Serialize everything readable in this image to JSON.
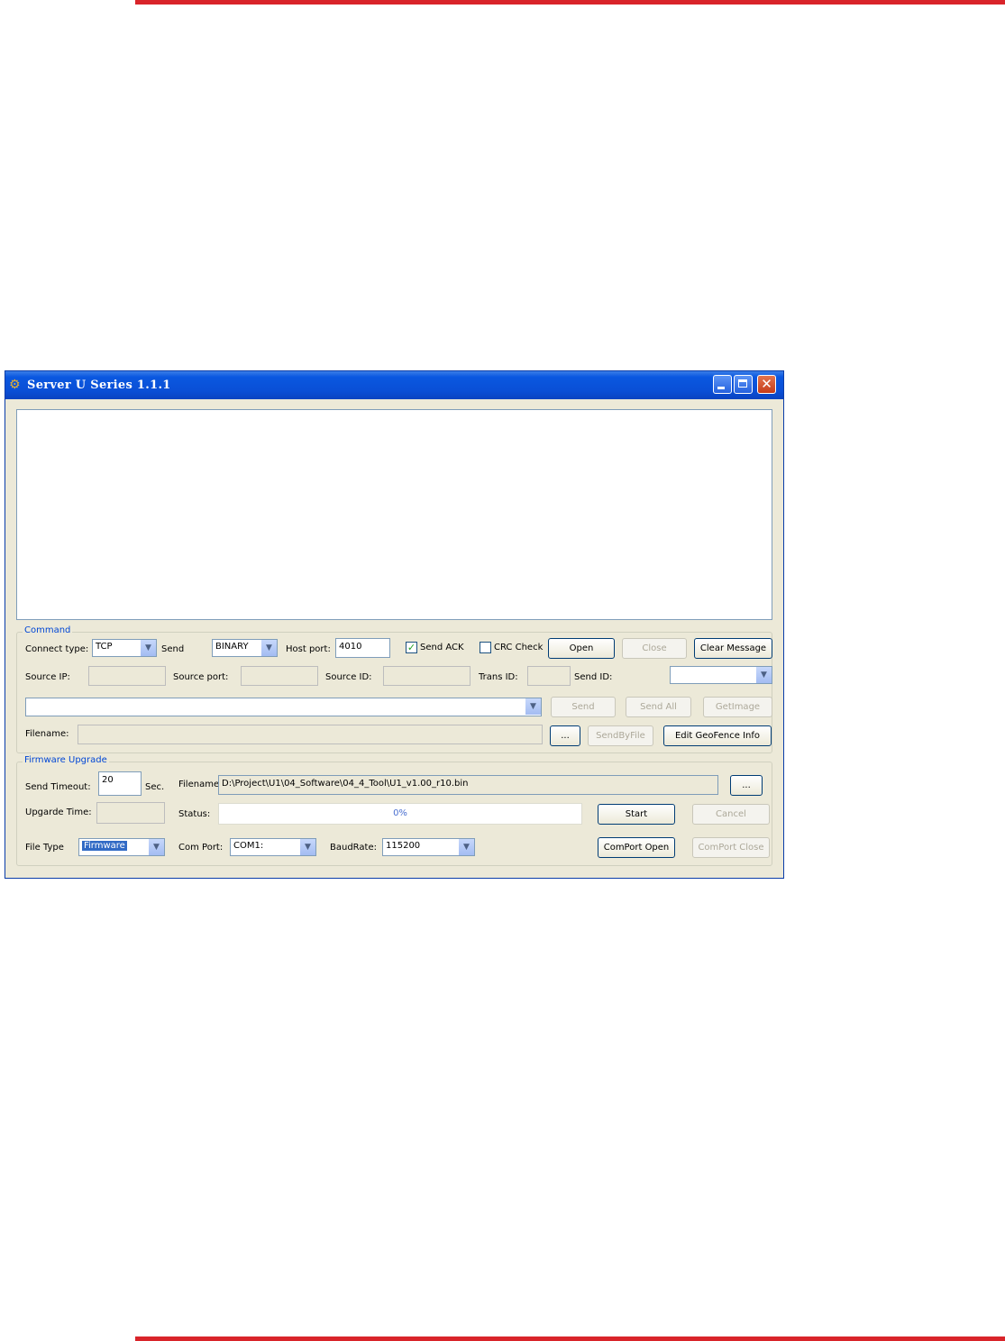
{
  "window": {
    "title": "Server U Series 1.1.1",
    "close_glyph": "✕"
  },
  "command": {
    "legend": "Command",
    "connect_type_label": "Connect type:",
    "connect_type_value": "TCP",
    "send_label": "Send",
    "send_value": "BINARY",
    "host_port_label": "Host port:",
    "host_port_value": "4010",
    "send_ack_label": "Send ACK",
    "send_ack_checked": true,
    "crc_check_label": "CRC Check",
    "crc_check_checked": false,
    "open_label": "Open",
    "close_label": "Close",
    "clear_message_label": "Clear Message",
    "source_ip_label": "Source IP:",
    "source_port_label": "Source port:",
    "source_id_label": "Source ID:",
    "trans_id_label": "Trans ID:",
    "send_id_label": "Send ID:",
    "send_btn_label": "Send",
    "send_all_label": "Send All",
    "getimage_label": "GetImage",
    "filename_label": "Filename:",
    "browse_label": "...",
    "sendbyfile_label": "SendByFile",
    "edit_geofence_label": "Edit GeoFence Info"
  },
  "firmware": {
    "legend": "Firmware Upgrade",
    "send_timeout_label": "Send Timeout:",
    "send_timeout_value": "20",
    "sec_label": "Sec.",
    "filename_label": "Filename",
    "filename_value": "D:\\Project\\U1\\04_Software\\04_4_Tool\\U1_v1.00_r10.bin",
    "browse_label": "...",
    "upgrade_time_label": "Upgarde Time:",
    "status_label": "Status:",
    "progress_text": "0%",
    "progress_fraction": 0,
    "start_label": "Start",
    "cancel_label": "Cancel",
    "file_type_label": "File Type",
    "file_type_value": "Firmware",
    "com_port_label": "Com Port:",
    "com_port_value": "COM1:",
    "baudrate_label": "BaudRate:",
    "baudrate_value": "115200",
    "comport_open_label": "ComPort Open",
    "comport_close_label": "ComPort Close"
  },
  "colors": {
    "accent_red": "#d9242a",
    "titlebar_blue": "#0a4fd6",
    "legend_blue": "#0046d5"
  }
}
